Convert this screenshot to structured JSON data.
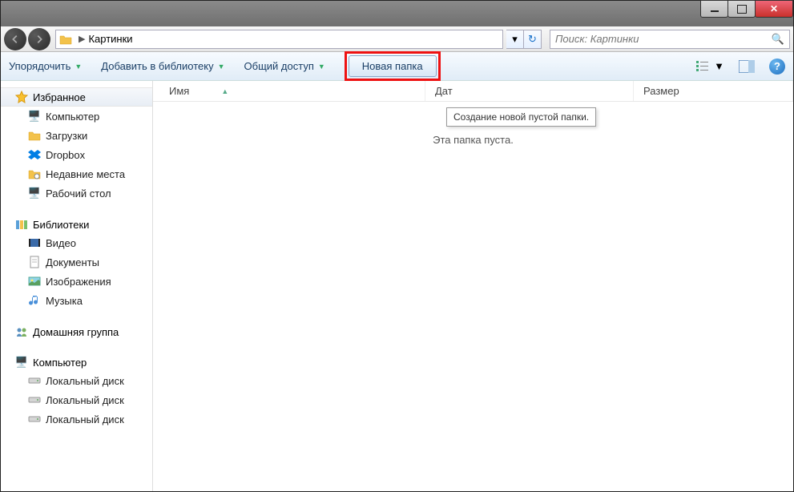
{
  "address": {
    "location": "Картинки"
  },
  "search": {
    "placeholder": "Поиск: Картинки"
  },
  "toolbar": {
    "organize": "Упорядочить",
    "add_library": "Добавить в библиотеку",
    "share": "Общий доступ",
    "new_folder": "Новая папка"
  },
  "tooltip": "Создание новой пустой папки.",
  "columns": {
    "name": "Имя",
    "date": "Дат",
    "size": "Размер"
  },
  "empty": "Эта папка пуста.",
  "sidebar": {
    "favorites": {
      "label": "Избранное",
      "items": [
        {
          "label": "Компьютер"
        },
        {
          "label": "Загрузки"
        },
        {
          "label": "Dropbox"
        },
        {
          "label": "Недавние места"
        },
        {
          "label": "Рабочий стол"
        }
      ]
    },
    "libraries": {
      "label": "Библиотеки",
      "items": [
        {
          "label": "Видео"
        },
        {
          "label": "Документы"
        },
        {
          "label": "Изображения"
        },
        {
          "label": "Музыка"
        }
      ]
    },
    "homegroup": {
      "label": "Домашняя группа"
    },
    "computer": {
      "label": "Компьютер",
      "items": [
        {
          "label": "Локальный диск"
        },
        {
          "label": "Локальный диск"
        },
        {
          "label": "Локальный диск"
        }
      ]
    }
  }
}
